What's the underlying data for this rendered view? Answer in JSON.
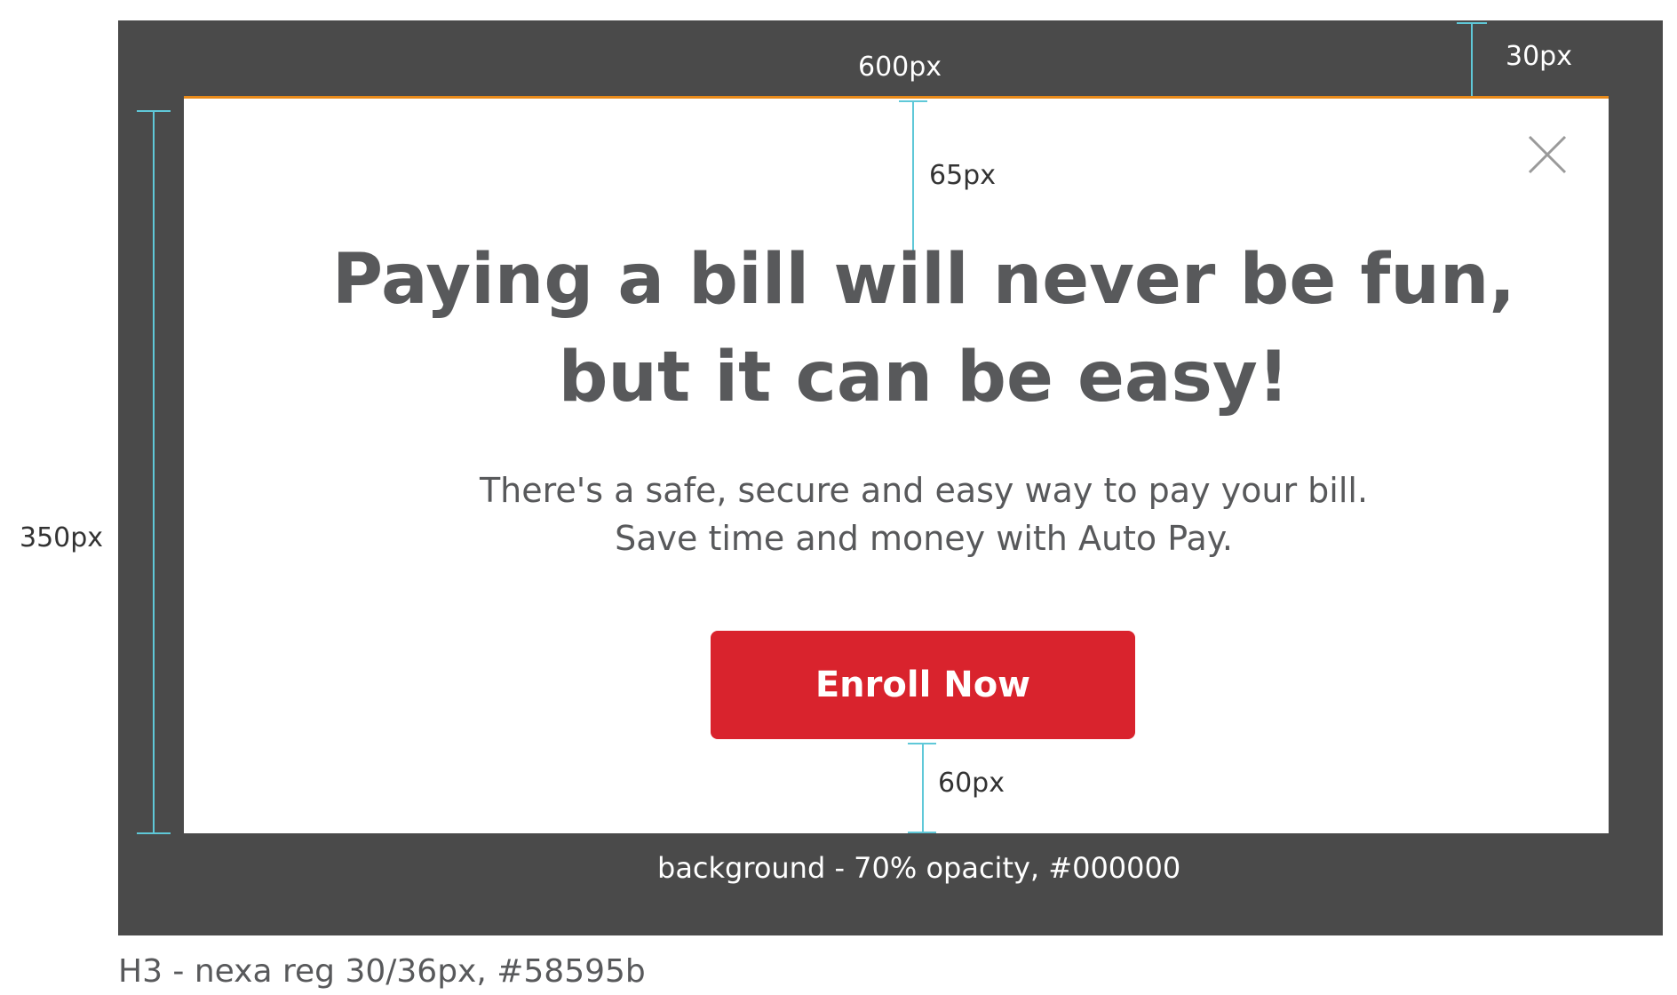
{
  "spec": {
    "width_label": "600px",
    "top_offset_label": "30px",
    "height_label": "350px",
    "top_padding_label": "65px",
    "bottom_padding_label": "60px",
    "background_note": "background - 70% opacity, #000000",
    "typography_note": "H3 - nexa reg 30/36px, #58595b"
  },
  "modal": {
    "headline_line1": "Paying a bill will never be fun,",
    "headline_line2": "but it can be easy!",
    "body_line1": "There's a safe, secure and easy way to pay your bill.",
    "body_line2": "Save time and money with Auto Pay.",
    "cta_label": "Enroll Now",
    "close_icon": "close-icon"
  },
  "colors": {
    "overlay": "#4a4a4a",
    "modal_bg": "#ffffff",
    "modal_top_border": "#e88a1a",
    "text": "#58595b",
    "cta_bg": "#d9232d",
    "cta_text": "#ffffff",
    "dimension_line": "#5fc8d8"
  }
}
